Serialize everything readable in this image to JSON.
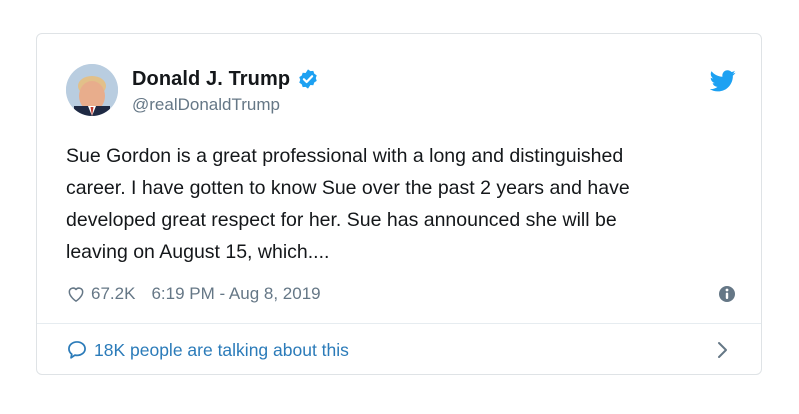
{
  "tweet": {
    "author": {
      "display_name": "Donald J. Trump",
      "handle": "@realDonaldTrump"
    },
    "text": "Sue Gordon is a great professional with a long and distinguished\ncareer. I have gotten to know Sue over the past 2 years and have\ndeveloped great respect for her. Sue has announced she will be\nleaving on August 15, which....",
    "likes": "67.2K",
    "timestamp": "6:19 PM - Aug 8, 2019",
    "footer_text": "18K people are talking about this"
  },
  "icons": {
    "verified": "verified-badge-icon",
    "brand": "twitter-bird-icon",
    "like": "heart-icon",
    "info": "info-icon",
    "conversation": "speech-bubble-icon",
    "more": "chevron-right-icon"
  },
  "colors": {
    "brand_blue": "#1da1f2",
    "link_blue": "#2b7bb9",
    "secondary_text": "#657786",
    "primary_text": "#14171a",
    "border": "#dfe3e6"
  }
}
